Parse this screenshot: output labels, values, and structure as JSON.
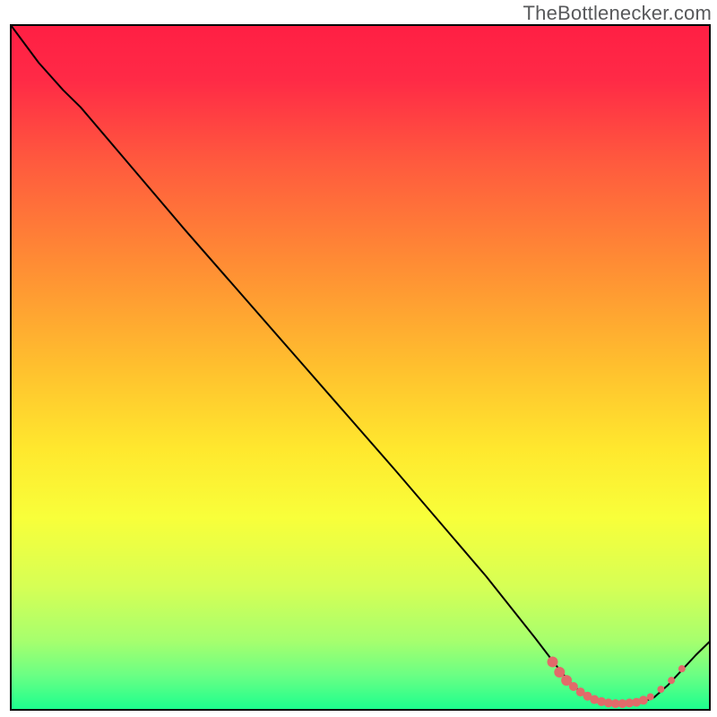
{
  "watermark": "TheBottlenecker.com",
  "chart_data": {
    "type": "line",
    "title": "",
    "xlabel": "",
    "ylabel": "",
    "xlim": [
      0,
      100
    ],
    "ylim": [
      0,
      100
    ],
    "grid": false,
    "legend": false,
    "background_gradient": [
      {
        "pos": 0.0,
        "color": "#ff1f44"
      },
      {
        "pos": 0.08,
        "color": "#ff2a46"
      },
      {
        "pos": 0.2,
        "color": "#ff5a3e"
      },
      {
        "pos": 0.35,
        "color": "#ff8d34"
      },
      {
        "pos": 0.5,
        "color": "#ffc02e"
      },
      {
        "pos": 0.62,
        "color": "#ffe82e"
      },
      {
        "pos": 0.72,
        "color": "#f8ff3a"
      },
      {
        "pos": 0.82,
        "color": "#d6ff55"
      },
      {
        "pos": 0.9,
        "color": "#a6ff6e"
      },
      {
        "pos": 0.95,
        "color": "#6aff84"
      },
      {
        "pos": 1.0,
        "color": "#1bff8e"
      }
    ],
    "frame": {
      "stroke": "#000000",
      "width": 2
    },
    "curve": {
      "stroke": "#000000",
      "width": 2,
      "points": [
        {
          "x": 0.0,
          "y": 100.0
        },
        {
          "x": 4.0,
          "y": 94.5
        },
        {
          "x": 7.5,
          "y": 90.5
        },
        {
          "x": 10.0,
          "y": 88.0
        },
        {
          "x": 15.0,
          "y": 82.0
        },
        {
          "x": 25.0,
          "y": 70.0
        },
        {
          "x": 40.0,
          "y": 52.5
        },
        {
          "x": 55.0,
          "y": 35.0
        },
        {
          "x": 68.0,
          "y": 19.5
        },
        {
          "x": 75.0,
          "y": 10.5
        },
        {
          "x": 78.0,
          "y": 6.5
        },
        {
          "x": 80.0,
          "y": 4.0
        },
        {
          "x": 82.0,
          "y": 2.2
        },
        {
          "x": 84.0,
          "y": 1.2
        },
        {
          "x": 86.0,
          "y": 0.8
        },
        {
          "x": 88.0,
          "y": 0.8
        },
        {
          "x": 90.0,
          "y": 1.0
        },
        {
          "x": 92.0,
          "y": 1.8
        },
        {
          "x": 94.0,
          "y": 3.6
        },
        {
          "x": 96.0,
          "y": 5.8
        },
        {
          "x": 98.0,
          "y": 8.0
        },
        {
          "x": 100.0,
          "y": 10.0
        }
      ]
    },
    "markers": {
      "fill": "#e26a6a",
      "stroke": "none",
      "points": [
        {
          "x": 77.5,
          "y": 7.0,
          "r": 6
        },
        {
          "x": 78.5,
          "y": 5.5,
          "r": 6
        },
        {
          "x": 79.5,
          "y": 4.3,
          "r": 6
        },
        {
          "x": 80.5,
          "y": 3.4,
          "r": 5
        },
        {
          "x": 81.5,
          "y": 2.6,
          "r": 5
        },
        {
          "x": 82.5,
          "y": 2.0,
          "r": 5
        },
        {
          "x": 83.5,
          "y": 1.5,
          "r": 5
        },
        {
          "x": 84.5,
          "y": 1.2,
          "r": 5
        },
        {
          "x": 85.5,
          "y": 1.0,
          "r": 5
        },
        {
          "x": 86.5,
          "y": 0.9,
          "r": 5
        },
        {
          "x": 87.5,
          "y": 0.9,
          "r": 5
        },
        {
          "x": 88.5,
          "y": 1.0,
          "r": 5
        },
        {
          "x": 89.5,
          "y": 1.1,
          "r": 5
        },
        {
          "x": 90.5,
          "y": 1.4,
          "r": 5
        },
        {
          "x": 91.5,
          "y": 1.9,
          "r": 4
        },
        {
          "x": 93.0,
          "y": 3.0,
          "r": 4
        },
        {
          "x": 94.5,
          "y": 4.3,
          "r": 4
        },
        {
          "x": 96.0,
          "y": 6.0,
          "r": 4
        }
      ]
    }
  }
}
